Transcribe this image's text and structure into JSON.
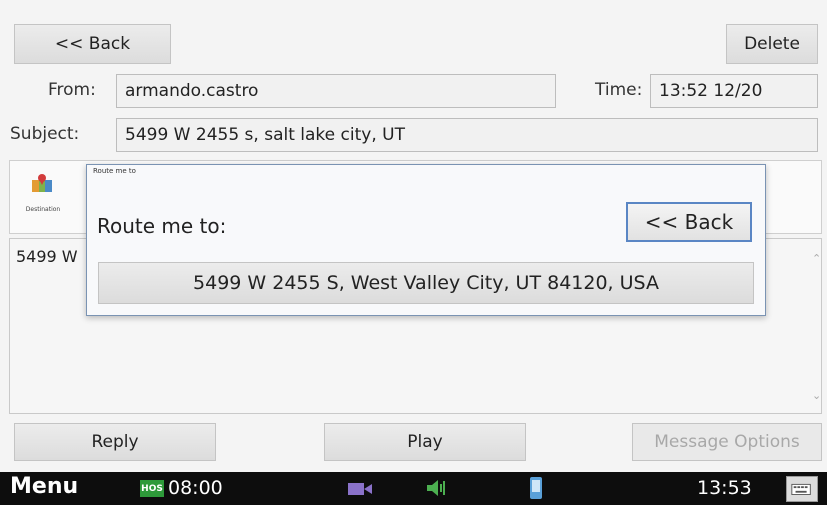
{
  "header": {
    "back_label": "<< Back",
    "delete_label": "Delete",
    "from_label": "From:",
    "from_value": "armando.castro",
    "time_label": "Time:",
    "time_value": "13:52  12/20",
    "subject_label": "Subject:",
    "subject_value": "5499 W 2455 s, salt lake city, UT"
  },
  "toolbar": {
    "destination_label": "Destination"
  },
  "body": {
    "text": "5499 W"
  },
  "dialog": {
    "title": "Route me to",
    "prompt": "Route me to:",
    "back_label": "<< Back",
    "option": "5499 W 2455 S, West Valley City, UT 84120, USA"
  },
  "actions": {
    "reply_label": "Reply",
    "play_label": "Play",
    "message_options_label": "Message Options"
  },
  "taskbar": {
    "menu_label": "Menu",
    "hos_badge": "HOS",
    "hos_time": "08:00",
    "clock": "13:53",
    "icons": [
      "camera-icon",
      "volume-icon",
      "phone-icon",
      "keyboard-icon"
    ]
  },
  "colors": {
    "taskbar_bg": "#0d0d0d",
    "hos_green": "#2e9a3a",
    "dialog_border": "#7a93b3",
    "focus_blue": "#5a86c4"
  }
}
